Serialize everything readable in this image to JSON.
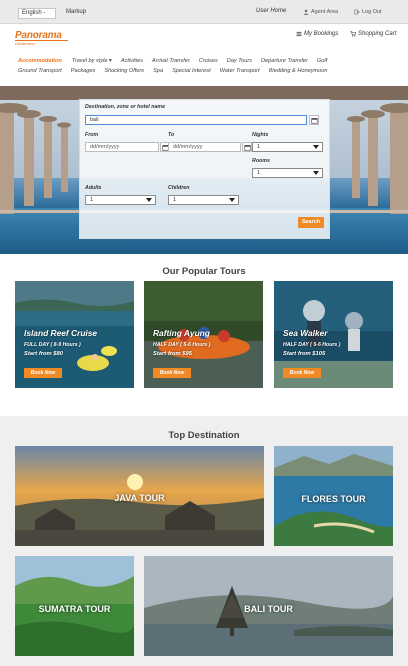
{
  "topbar": {
    "language": "English -",
    "markup": "Markup",
    "user_home": "User Home",
    "agent_area": "Agent Area",
    "logout": "Log Out"
  },
  "brand": {
    "logo_text": "Panorama",
    "logo_tagline": "Destination",
    "accent_color": "#e8731c"
  },
  "account": {
    "my_bookings": "My Bookings",
    "shopping_cart": "Shopping Cart"
  },
  "nav": {
    "row1": [
      "Accommodation",
      "Travel by style ▾",
      "Activities",
      "Arrival Transfer",
      "Cruises",
      "Day Tours",
      "Departure Transfer",
      "Golf"
    ],
    "row2": [
      "Ground Transport",
      "Packages",
      "Shocking Offers",
      "Spa",
      "Special Interest",
      "Water Transport",
      "Wedding & Honeymoon"
    ],
    "active": "Accommodation"
  },
  "search": {
    "destination_label": "Destination, zone or hotel name",
    "destination_value": "bali",
    "from_label": "From",
    "to_label": "To",
    "date_placeholder": "dd/mm/yyyy",
    "nights_label": "Nights",
    "nights_value": "1",
    "rooms_label": "Rooms",
    "rooms_value": "1",
    "adults_label": "Adults",
    "adults_value": "1",
    "children_label": "Children",
    "children_value": "1",
    "search_button": "Search"
  },
  "popular_tours": {
    "title": "Our Popular Tours",
    "items": [
      {
        "name": "Island Reef Cruise",
        "duration": "FULL DAY ( 8-9 Hours )",
        "price": "Start from $80",
        "button": "Book Now"
      },
      {
        "name": "Rafting Ayung",
        "duration": "HALF DAY ( 5-6 Hours )",
        "price": "Start from $95",
        "button": "Book Now"
      },
      {
        "name": "Sea Walker",
        "duration": "HALF DAY ( 5-6 Hours )",
        "price": "Start from $105",
        "button": "Book Now"
      }
    ]
  },
  "top_destination": {
    "title": "Top Destination",
    "items": [
      "JAVA TOUR",
      "FLORES TOUR",
      "SUMATRA TOUR",
      "BALI TOUR"
    ]
  }
}
